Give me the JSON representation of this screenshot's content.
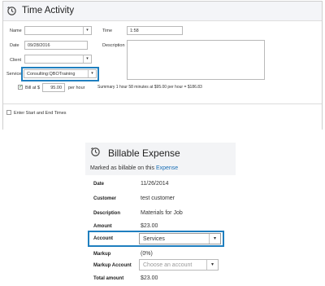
{
  "time_activity": {
    "title": "Time Activity",
    "labels": {
      "name": "Name",
      "date": "Date",
      "client": "Client",
      "service": "Service",
      "time": "Time",
      "description": "Description",
      "bill_at": "Bill at $",
      "per_hour": "per hour",
      "enter_start_end": "Enter Start and End Times"
    },
    "values": {
      "name": "",
      "date": "09/28/2016",
      "client": "",
      "service": "Consulting:QBOTraining",
      "time": "1:58",
      "rate": "95.00",
      "billable_checked": true,
      "start_end_checked": false
    },
    "summary": "Summary  1 hour 58 minutes at $95.00 per hour = $186.83",
    "dropdown_glyph": "▾",
    "check_glyph": "✓"
  },
  "billable_expense": {
    "title": "Billable Expense",
    "marked_text": "Marked as billable on this ",
    "marked_link": "Expense",
    "rows": {
      "date_label": "Date",
      "date_value": "11/26/2014",
      "customer_label": "Customer",
      "customer_value": "test customer",
      "description_label": "Description",
      "description_value": "Materials for Job",
      "amount_label": "Amount",
      "amount_value": "$23.00",
      "account_label": "Account",
      "account_value": "Services",
      "markup_label": "Markup",
      "markup_value": "(0%)",
      "markup_account_label": "Markup Account",
      "markup_account_placeholder": "Choose an account",
      "total_label": "Total amount",
      "total_value": "$23.00"
    },
    "dropdown_glyph": "▾"
  },
  "colors": {
    "highlight": "#1f7fbf",
    "link": "#1a6fb5",
    "header_bg": "#f4f5f8"
  }
}
